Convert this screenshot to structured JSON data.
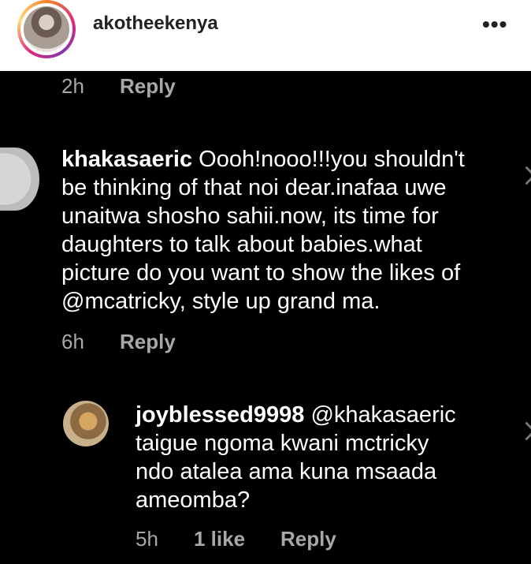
{
  "header": {
    "username": "akotheekenya",
    "more_label": "•••"
  },
  "comments": [
    {
      "time": "2h",
      "reply_label": "Reply"
    },
    {
      "author": "khakasaeric",
      "lines": [
        "Oooh!nooo!!!you shouldn't",
        "be thinking of that noi dear.inafaa uwe",
        "unaitwa shosho sahii.now, its time for",
        "daughters to talk about babies.what",
        "picture do you want to show the likes of",
        "@mcatricky, style up grand ma."
      ],
      "time": "6h",
      "reply_label": "Reply"
    },
    {
      "author": "joyblessed9998",
      "lines": [
        "@khakasaeric",
        "taigue ngoma kwani mctricky",
        "ndo atalea ama kuna msaada",
        "ameomba?"
      ],
      "time": "5h",
      "likes": "1 like",
      "reply_label": "Reply"
    }
  ],
  "colors": {
    "background": "#000000",
    "header_bg": "#ffffff",
    "meta_text": "#a8a8a8",
    "comment_text": "#ffffff"
  }
}
